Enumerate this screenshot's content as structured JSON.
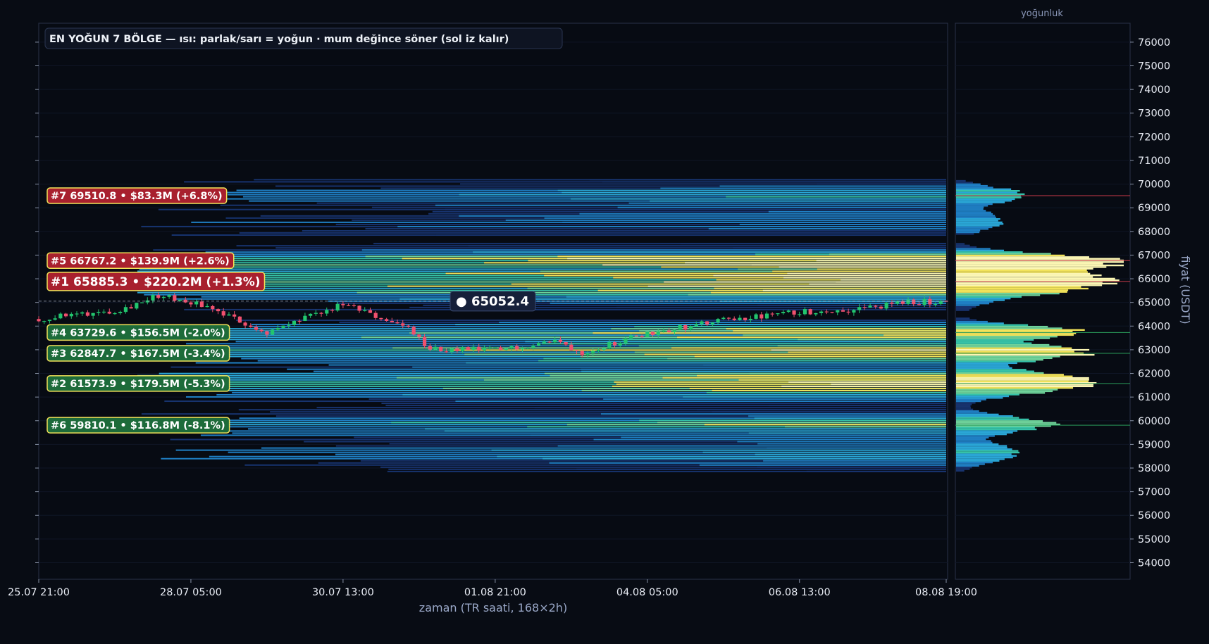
{
  "chart_data": {
    "type": "candlestick-heatmap",
    "title": "EN YOĞUN 7 BÖLGE — ısı: parlak/sarı = yoğun · mum değince söner (sol iz kalır)",
    "xlabel": "zaman (TR saati, 168×2h)",
    "ylabel": "fiyat (USDT)",
    "side_title": "yoğunluk",
    "ylim": [
      53300,
      76800
    ],
    "x_ticks": [
      "25.07 21:00",
      "28.07 05:00",
      "30.07 13:00",
      "01.08 21:00",
      "04.08 05:00",
      "06.08 13:00",
      "08.08 19:00"
    ],
    "x_tick_index": [
      0,
      28,
      56,
      84,
      112,
      140,
      167
    ],
    "y_ticks": [
      54000,
      55000,
      56000,
      57000,
      58000,
      59000,
      60000,
      61000,
      62000,
      63000,
      64000,
      65000,
      66000,
      67000,
      68000,
      69000,
      70000,
      71000,
      72000,
      73000,
      74000,
      75000,
      76000
    ],
    "y_tick_labels": [
      "54000",
      "55000",
      "56000",
      "57000",
      "58000",
      "59000",
      "60000",
      "61000",
      "62000",
      "63000",
      "64000",
      "65000",
      "66000",
      "67000",
      "68000",
      "69000",
      "70000",
      "71000",
      "72000",
      "73000",
      "74000",
      "75000",
      "76000"
    ],
    "current_price": 65052.4,
    "current_price_label": "● 65052.4",
    "candle_count": 168,
    "zones": [
      {
        "rank": 7,
        "price": 69510.8,
        "label": "#7  69510.8  •  $83.3M  (+6.8%)",
        "side": "above"
      },
      {
        "rank": 5,
        "price": 66767.2,
        "label": "#5  66767.2  •  $139.9M  (+2.6%)",
        "side": "above"
      },
      {
        "rank": 1,
        "price": 65885.3,
        "label": "#1  65885.3  •  $220.2M  (+1.3%)",
        "side": "above",
        "major": true
      },
      {
        "rank": 4,
        "price": 63729.6,
        "label": "#4  63729.6  •  $156.5M  (-2.0%)",
        "side": "below"
      },
      {
        "rank": 3,
        "price": 62847.7,
        "label": "#3  62847.7  •  $167.5M  (-3.4%)",
        "side": "below"
      },
      {
        "rank": 2,
        "price": 61573.9,
        "label": "#2  61573.9  •  $179.5M  (-5.3%)",
        "side": "below"
      },
      {
        "rank": 6,
        "price": 59810.1,
        "label": "#6  59810.1  •  $116.8M  (-8.1%)",
        "side": "below"
      }
    ],
    "colors": {
      "bg": "#080c14",
      "up": "#22c56e",
      "down": "#f0506e",
      "above": "#a8202e",
      "below": "#1d6b3a",
      "yellow": "#f2e35a"
    }
  }
}
